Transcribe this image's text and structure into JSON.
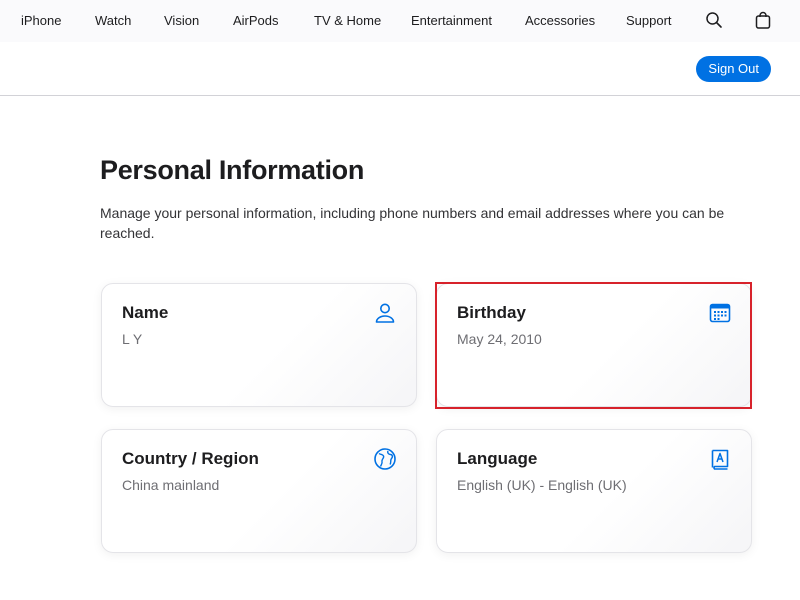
{
  "nav": {
    "items": [
      "iPhone",
      "Watch",
      "Vision",
      "AirPods",
      "TV & Home",
      "Entertainment",
      "Accessories",
      "Support"
    ],
    "icons": [
      "search-icon",
      "bag-icon"
    ]
  },
  "subnav": {
    "signout_label": "Sign Out"
  },
  "page": {
    "title": "Personal Information",
    "description": "Manage your personal information, including phone numbers and email addresses where you can be reached."
  },
  "cards": {
    "name": {
      "title": "Name",
      "value": "L Y",
      "icon": "person-icon"
    },
    "birthday": {
      "title": "Birthday",
      "value": "May 24, 2010",
      "icon": "calendar-icon"
    },
    "country": {
      "title": "Country / Region",
      "value": "China mainland",
      "icon": "globe-icon"
    },
    "language": {
      "title": "Language",
      "value": "English (UK) - English (UK)",
      "icon": "book-icon"
    }
  },
  "colors": {
    "accent": "#0071e3",
    "highlight": "#d7222b",
    "icon": "#0071e3"
  }
}
